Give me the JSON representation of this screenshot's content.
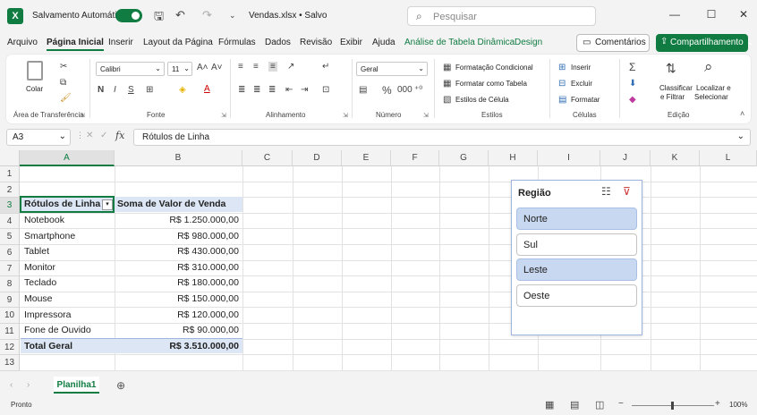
{
  "titlebar": {
    "autosave_label": "Salvamento Automático",
    "filename": "Vendas.xlsx • Salvo",
    "search_placeholder": "Pesquisar"
  },
  "menu": {
    "tabs": [
      "Arquivo",
      "Página Inicial",
      "Inserir",
      "Layout da Página",
      "Fórmulas",
      "Dados",
      "Revisão",
      "Exibir",
      "Ajuda",
      "Análise de Tabela Dinâmica",
      "Design"
    ],
    "comments_label": "Comentários",
    "share_label": "Compartilhamento"
  },
  "ribbon": {
    "paste_label": "Colar",
    "clipboard_label": "Área de Transferência",
    "font_name": "Calibri",
    "font_size": "11",
    "font_label": "Fonte",
    "alignment_label": "Alinhamento",
    "number_format": "Geral",
    "number_label": "Número",
    "conditional_formatting": "Formatação Condicional",
    "format_as_table": "Formatar como Tabela",
    "cell_styles": "Estilos de Célula",
    "styles_label": "Estilos",
    "insert": "Inserir",
    "delete": "Excluir",
    "format": "Formatar",
    "cells_label": "Células",
    "sort_filter_1": "Classificar",
    "sort_filter_2": "e Filtrar",
    "find_select_1": "Localizar e",
    "find_select_2": "Selecionar",
    "editing_label": "Edição"
  },
  "formula_bar": {
    "name_box": "A3",
    "formula": "Rótulos de Linha"
  },
  "sheet": {
    "columns": [
      "A",
      "B",
      "C",
      "D",
      "E",
      "F",
      "G",
      "H",
      "I",
      "J",
      "K",
      "L"
    ],
    "rows": [
      "1",
      "2",
      "3",
      "4",
      "5",
      "6",
      "7",
      "8",
      "9",
      "10",
      "11",
      "12",
      "13"
    ],
    "pivot_header": [
      "Rótulos de Linha",
      "Soma de Valor de Venda"
    ],
    "pivot_rows": [
      [
        "Notebook",
        "R$ 1.250.000,00"
      ],
      [
        "Smartphone",
        "R$ 980.000,00"
      ],
      [
        "Tablet",
        "R$ 430.000,00"
      ],
      [
        "Monitor",
        "R$ 310.000,00"
      ],
      [
        "Teclado",
        "R$ 180.000,00"
      ],
      [
        "Mouse",
        "R$ 150.000,00"
      ],
      [
        "Impressora",
        "R$ 120.000,00"
      ],
      [
        "Fone de Ouvido",
        "R$ 90.000,00"
      ]
    ],
    "total_row": [
      "Total Geral",
      "R$ 3.510.000,00"
    ]
  },
  "slicer": {
    "title": "Região",
    "items": [
      {
        "label": "Norte",
        "selected": true
      },
      {
        "label": "Sul",
        "selected": false
      },
      {
        "label": "Leste",
        "selected": true
      },
      {
        "label": "Oeste",
        "selected": false
      }
    ]
  },
  "sheet_tabs": [
    "Planilha1"
  ],
  "status": {
    "ready": "Pronto",
    "zoom": "100%"
  },
  "colors": {
    "accent": "#107c41",
    "pivot_band": "#dce6f4",
    "slicer_selected": "#c8d8f1"
  }
}
